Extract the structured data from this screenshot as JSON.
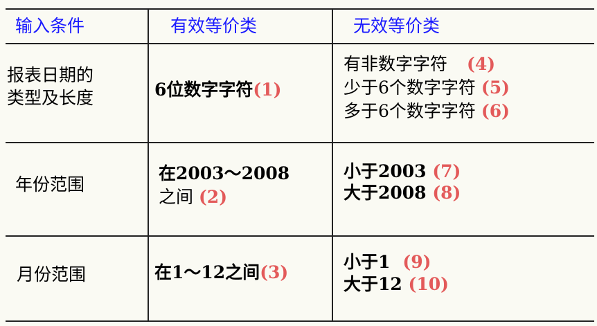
{
  "headers": {
    "col1": "输入条件",
    "col2": "有效等价类",
    "col3": "无效等价类"
  },
  "rows": [
    {
      "condition": [
        "报表日期的",
        "类型及长度"
      ],
      "valid": {
        "text": "6位数字字符",
        "num": "(1)"
      },
      "invalid": [
        {
          "text": "有非数字字符",
          "num": "(4)"
        },
        {
          "text": "少于6个数字字符",
          "num": "(5)"
        },
        {
          "text": "多于6个数字字符",
          "num": "(6)"
        }
      ]
    },
    {
      "condition": [
        "年份范围"
      ],
      "valid": {
        "line1": "在2003～2008",
        "line2": "之间",
        "num": "(2)"
      },
      "invalid": [
        {
          "text": "小于2003",
          "num": "(7)"
        },
        {
          "text": "大于2008",
          "num": "(8)"
        }
      ]
    },
    {
      "condition": [
        "月份范围"
      ],
      "valid": {
        "text": "在1～12之间",
        "num": "(3)"
      },
      "invalid": [
        {
          "text": "小于1",
          "num": "(9)"
        },
        {
          "text": "大于12",
          "num": "(10)"
        }
      ]
    }
  ],
  "colors": {
    "header": "#1a1aff",
    "number": "#e35a5a",
    "background": "#fafaf3"
  }
}
